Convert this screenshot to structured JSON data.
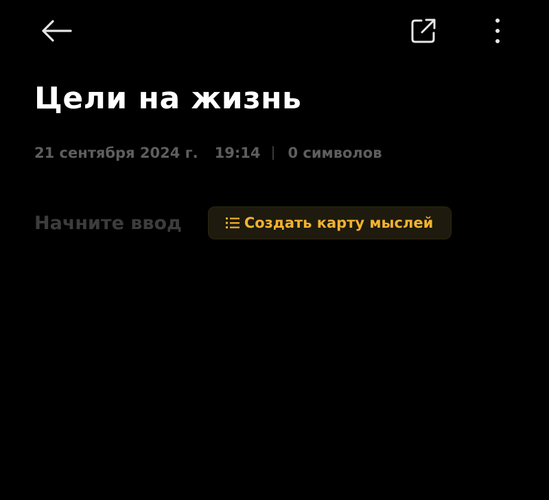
{
  "toolbar": {
    "back_icon": "arrow-left-icon",
    "share_icon": "open-external-icon",
    "more_icon": "more-vertical-icon"
  },
  "note": {
    "title": "Цели на жизнь",
    "date": "21 сентября 2024 г.",
    "time": "19:14",
    "char_count": "0 символов"
  },
  "editor": {
    "placeholder": "Начните ввод",
    "mindmap_button_label": "Создать карту мыслей",
    "mindmap_icon": "list-icon"
  },
  "colors": {
    "background": "#000000",
    "title": "#ffffff",
    "meta": "#5e5e5e",
    "placeholder": "#3c3c3c",
    "accent": "#f2b230",
    "button_bg": "#1e1a0e"
  }
}
